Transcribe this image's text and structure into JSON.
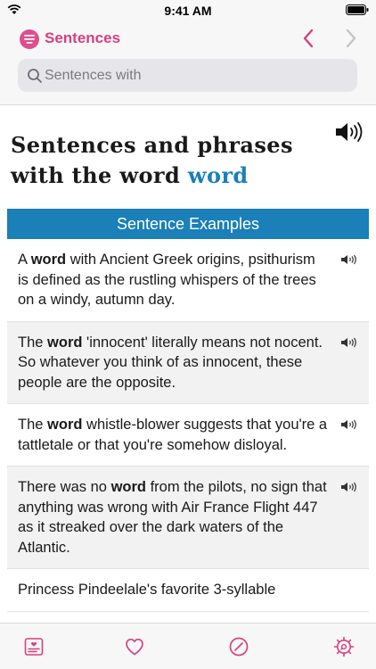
{
  "status_bar": {
    "time": "9:41 AM"
  },
  "nav": {
    "title": "Sentences"
  },
  "search": {
    "placeholder": "Sentences with"
  },
  "heading": {
    "line1": "Sentences and phrases",
    "line2_prefix": "with the word ",
    "keyword": "word"
  },
  "section": {
    "title": "Sentence Examples"
  },
  "examples": [
    {
      "before": "A ",
      "keyword": "word",
      "after": " with Ancient Greek origins, psithurism is defined as the rustling whispers of the trees on a windy, autumn day."
    },
    {
      "before": "The ",
      "keyword": "word",
      "after": " 'innocent' literally means not nocent. So whatever you think of as innocent, these people are the opposite."
    },
    {
      "before": "The ",
      "keyword": "word",
      "after": " whistle-blower suggests that you're a tattletale or that you're somehow disloyal."
    },
    {
      "before": "There was no ",
      "keyword": "word",
      "after": " from the pilots, no sign that anything was wrong with Air France Flight 447 as it streaked over the dark waters of the Atlantic."
    },
    {
      "before": "Princess Pindeelale's favorite 3-syllable ",
      "keyword": "",
      "after": ""
    }
  ],
  "icons": {
    "menu": "list-icon",
    "back": "chevron-left-icon",
    "forward": "chevron-right-icon",
    "search": "search-icon",
    "speaker": "speaker-icon",
    "tabs": [
      "flashcard-icon",
      "heart-icon",
      "compass-icon",
      "settings-gear-icon"
    ]
  },
  "colors": {
    "accent_pink": "#d6407f",
    "accent_blue": "#1b7fb8",
    "row_alt": "#f2f2f3"
  }
}
